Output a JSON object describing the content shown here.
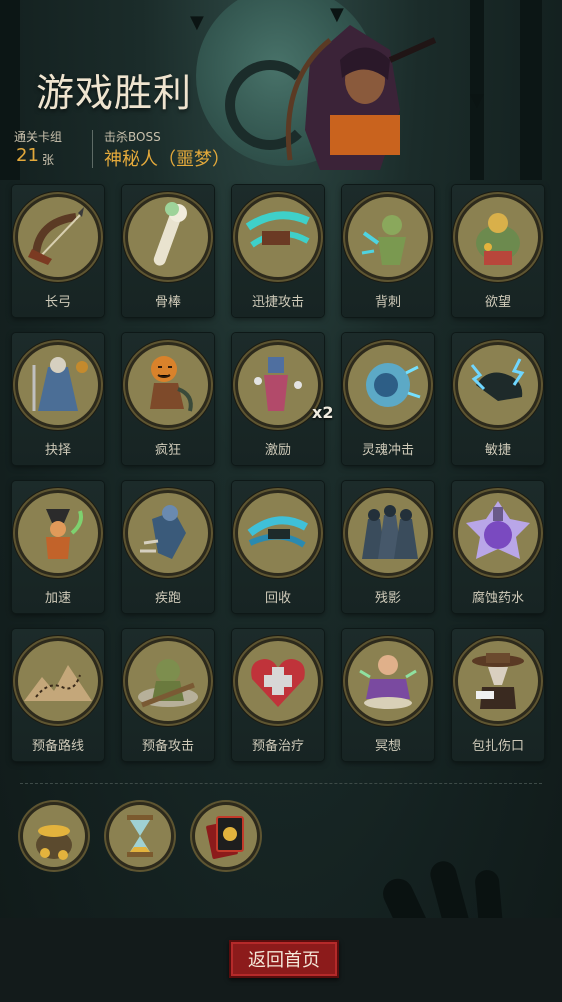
{
  "header": {
    "title": "游戏胜利",
    "stages_label": "通关卡组",
    "stages_value": "21",
    "stages_unit": "张",
    "boss_label": "击杀BOSS",
    "boss_value": "神秘人（噩梦）"
  },
  "cards": [
    {
      "name": "长弓",
      "icon": "longbow-icon"
    },
    {
      "name": "骨棒",
      "icon": "bone-club-icon"
    },
    {
      "name": "迅捷攻击",
      "icon": "swift-attack-icon"
    },
    {
      "name": "背刺",
      "icon": "backstab-icon"
    },
    {
      "name": "欲望",
      "icon": "desire-icon"
    },
    {
      "name": "抉择",
      "icon": "choice-icon"
    },
    {
      "name": "疯狂",
      "icon": "madness-icon"
    },
    {
      "name": "激励",
      "icon": "inspire-icon",
      "badge": "x2"
    },
    {
      "name": "灵魂冲击",
      "icon": "soul-strike-icon"
    },
    {
      "name": "敏捷",
      "icon": "agility-icon"
    },
    {
      "name": "加速",
      "icon": "haste-icon"
    },
    {
      "name": "疾跑",
      "icon": "sprint-icon"
    },
    {
      "name": "回收",
      "icon": "recycle-icon"
    },
    {
      "name": "残影",
      "icon": "afterimage-icon"
    },
    {
      "name": "腐蚀药水",
      "icon": "corrosive-potion-icon"
    },
    {
      "name": "预备路线",
      "icon": "prepared-route-icon"
    },
    {
      "name": "预备攻击",
      "icon": "prepared-attack-icon"
    },
    {
      "name": "预备治疗",
      "icon": "prepared-heal-icon"
    },
    {
      "name": "冥想",
      "icon": "meditation-icon"
    },
    {
      "name": "包扎伤口",
      "icon": "bandage-wound-icon"
    }
  ],
  "items": [
    {
      "icon": "gold-pot-icon"
    },
    {
      "icon": "hourglass-icon"
    },
    {
      "icon": "card-deck-icon"
    }
  ],
  "footer": {
    "home_label": "返回首页"
  },
  "colors": {
    "accent_gold": "#e3a93b",
    "button_red": "#8c1b1b",
    "medal_base": "#8b8151"
  }
}
